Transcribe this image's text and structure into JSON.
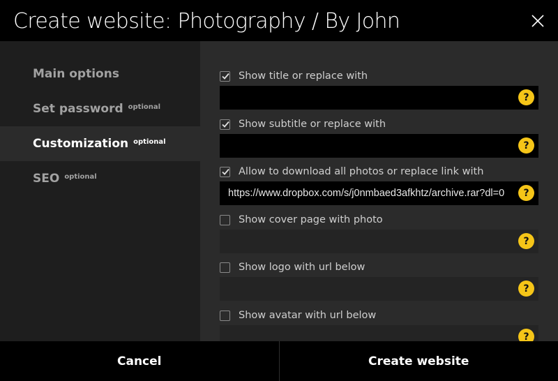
{
  "header": {
    "title": "Create website: Photography / By John",
    "close_icon": "close-icon"
  },
  "sidebar": {
    "items": [
      {
        "label": "Main options",
        "badge": "",
        "active": false
      },
      {
        "label": "Set password",
        "badge": "optional",
        "active": false
      },
      {
        "label": "Customization",
        "badge": "optional",
        "active": true
      },
      {
        "label": "SEO",
        "badge": "optional",
        "active": false
      }
    ]
  },
  "options": [
    {
      "label": "Show title or replace with",
      "checked": true,
      "value": "",
      "help": "?"
    },
    {
      "label": "Show subtitle or replace with",
      "checked": true,
      "value": "",
      "help": "?"
    },
    {
      "label": "Allow to download all photos or replace link with",
      "checked": true,
      "value": "https://www.dropbox.com/s/j0nmbaed3afkhtz/archive.rar?dl=0",
      "help": "?"
    },
    {
      "label": "Show cover page with photo",
      "checked": false,
      "value": "",
      "help": "?"
    },
    {
      "label": "Show logo with url below",
      "checked": false,
      "value": "",
      "help": "?"
    },
    {
      "label": "Show avatar with url below",
      "checked": false,
      "value": "",
      "help": "?"
    }
  ],
  "footer": {
    "cancel_label": "Cancel",
    "create_label": "Create website"
  },
  "colors": {
    "accent": "#f5c518",
    "panel": "#2b2b2b",
    "sidebar": "#1e1e1e"
  }
}
